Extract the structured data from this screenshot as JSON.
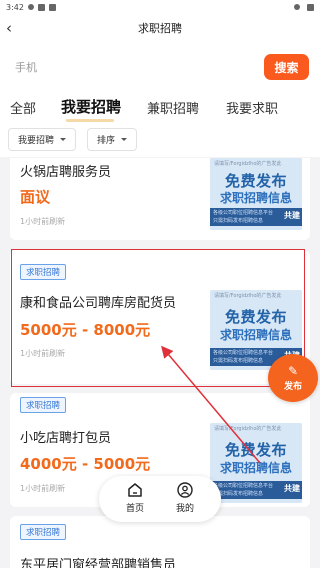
{
  "status_bar": {
    "time": "3:42"
  },
  "navbar": {
    "title": "求职招聘"
  },
  "search": {
    "placeholder": "手机",
    "button_label": "搜索"
  },
  "tabs": [
    {
      "label": "全部"
    },
    {
      "label": "我要招聘",
      "active": true
    },
    {
      "label": "兼职招聘"
    },
    {
      "label": "我要求职"
    }
  ],
  "filters": [
    {
      "label": "我要招聘"
    },
    {
      "label": "排序"
    }
  ],
  "ad": {
    "top_line": "请填写/Forgidzlho的广告发此",
    "line1": "免费发布",
    "line2": "求职招聘信息",
    "strip_line1": "各级公司职位招聘信息平台",
    "strip_line2": "只需扫码发布招聘信息",
    "share": "共建"
  },
  "jobs": [
    {
      "tag": "",
      "title": "火锅店聘服务员",
      "salary": "面议",
      "time": "1小时前刷新"
    },
    {
      "tag": "求职招聘",
      "title": "康和食品公司聘库房配货员",
      "salary": "5000元 - 8000元",
      "time": "1小时前刷新"
    },
    {
      "tag": "求职招聘",
      "title": "小吃店聘打包员",
      "salary": "4000元 - 5000元",
      "time": "1小时前刷新"
    },
    {
      "tag": "求职招聘",
      "title": "东平居门窗经营部聘销售员",
      "salary": "",
      "time": ""
    }
  ],
  "publish_button": {
    "label": "发布"
  },
  "bottom_nav": [
    {
      "label": "首页",
      "icon": "home-icon"
    },
    {
      "label": "我的",
      "icon": "profile-icon"
    }
  ],
  "colors": {
    "accent": "#fa5a1d",
    "salary": "#f26a1b",
    "tag": "#3a7ad6",
    "highlight": "#e0303a"
  }
}
